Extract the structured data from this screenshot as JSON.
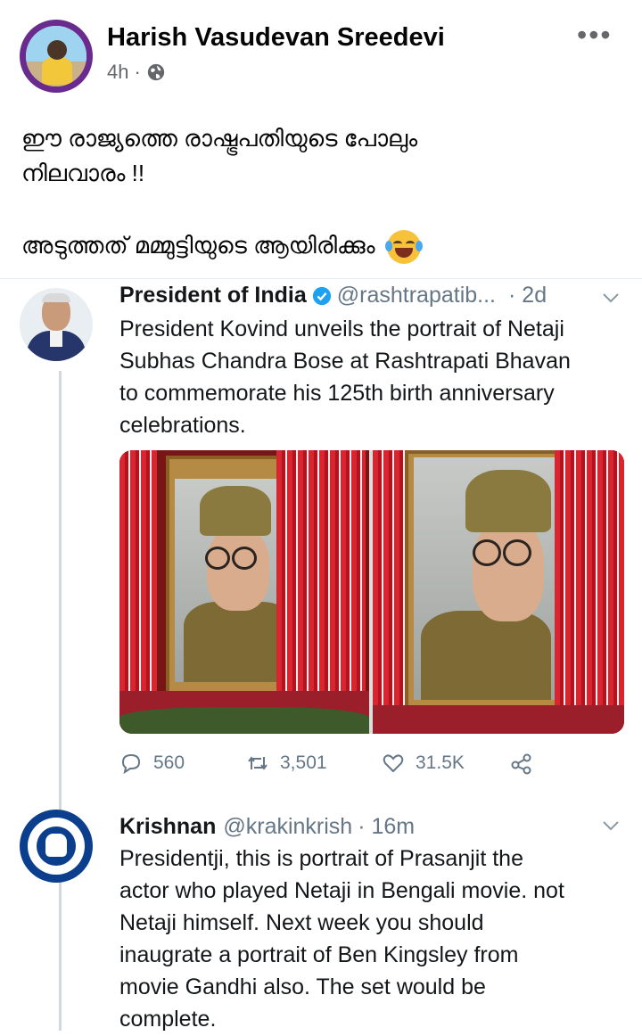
{
  "post": {
    "author": "Harish Vasudevan Sreedevi",
    "time": "4h",
    "separator": "·",
    "more_label": "•••",
    "text_lines": [
      "ഈ രാജ്യത്തെ രാഷ്ട്രപതിയുടെ പോലും",
      "നിലവാരം !!",
      "അടുത്തത് മമ്മുട്ടിയുടെ ആയിരിക്കും"
    ]
  },
  "tweet1": {
    "name": "President of India",
    "handle": "@rashtrapatib...",
    "time": "· 2d",
    "body_lines": [
      "President Kovind unveils the portrait of Netaji",
      "Subhas Chandra Bose at Rashtrapati Bhavan",
      "to commemorate his 125th birth anniversary",
      "celebrations."
    ],
    "replies": "560",
    "retweets": "3,501",
    "likes": "31.5K"
  },
  "tweet2": {
    "name": "Krishnan",
    "handle": "@krakinkrish",
    "time": "· 16m",
    "body_lines": [
      "Presidentji, this is portrait of Prasanjit the",
      "actor who played Netaji in Bengali movie. not",
      "Netaji himself.  Next week you should",
      "inaugrate a portrait of Ben Kingsley from",
      "movie Gandhi also. The set would be",
      "complete."
    ]
  },
  "colors": {
    "fb_text": "#050505",
    "fb_meta": "#65676b",
    "tw_text": "#14171a",
    "tw_meta": "#657786",
    "verified": "#1da1f2"
  },
  "icons": [
    "globe-icon",
    "more-options-icon",
    "laughing-emoji-icon",
    "verified-badge-icon",
    "chevron-down-icon",
    "reply-icon",
    "retweet-icon",
    "like-icon",
    "share-icon"
  ]
}
